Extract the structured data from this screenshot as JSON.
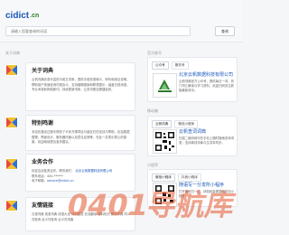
{
  "logo": {
    "text_primary": "cidict",
    "text_dot": ".cn",
    "text_sub": ""
  },
  "search": {
    "placeholder": "请输入您要查询的词语",
    "button_label": "查询"
  },
  "left": {
    "section_label": "关于词典",
    "about": {
      "title": "关于词典",
      "text": "云帆词典收录丰富的中英文词条，提供中英双语释义、例句和用法说明，帮助用户快速查询词语含义。支持模糊搜索和联想提示，涵盖日常用语、专业术语和网络新词，持续更新词库，让查词更加便捷高效。"
    },
    "features": {
      "title": "特别鸣谢",
      "text": "本站在建设过程中得到了众多开源项目与朋友们的支持与帮助，包括数据整理、界面设计、服务器托管以及意见反馈等，在此一并表示衷心的感谢。欢迎继续提出宝贵建议。"
    },
    "business": {
      "title": "业务合作",
      "text": "欢迎洽谈各类合作。联系我们：",
      "company": "北京云帆数据科技有限公司",
      "contact_label": "联系电话：",
      "phone": "400-******",
      "email_label": "电子邮箱：",
      "email": "service@cidict.cn"
    },
    "links": {
      "title": "友情链接",
      "text": "汉语词典 英语词典 成语大全 诗词鉴赏 在线翻译 百科知识 新华字典 同义词查询 反义词查询 近义词词典"
    }
  },
  "right": {
    "panel1": {
      "label": "官方账号",
      "tabs": [
        "公众号",
        "服务号"
      ],
      "title": "北京云帆数据科技有限公司",
      "text": "云帆词典官方公众号，提供每日一词、热门词汇解读与学习资料，欢迎扫码关注获取最新资讯。"
    },
    "panel2": {
      "label": "移动端",
      "tabs": [
        "云帆词典",
        "微信小程序"
      ],
      "title": "云帆查词词典",
      "text": "扫描二维码即可在手机上随时随地查询词语，支持离线词库与生词本同步。"
    },
    "panel3": {
      "label": "小程序",
      "tabs": [
        "微信小程序",
        "抖音小程序"
      ],
      "title": "随语写一分发所小程序",
      "text": "打开微信扫一扫，体验轻量便捷的查词小程序。"
    }
  },
  "watermark": {
    "text": "0401导航库"
  },
  "colors": {
    "accent": "#1a56b8",
    "icon_red": "#e84a3c",
    "icon_yellow": "#f2c12e",
    "icon_blue": "#2f6fd6",
    "watermark": "#e4572e"
  }
}
